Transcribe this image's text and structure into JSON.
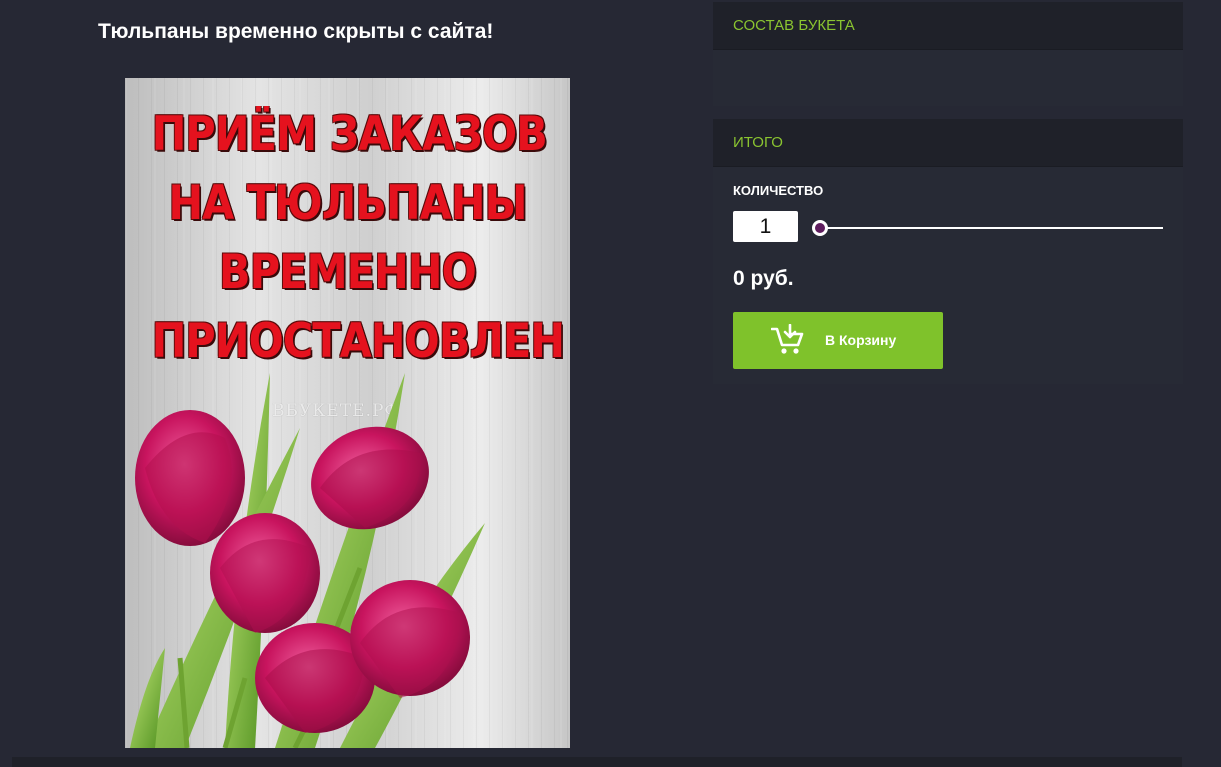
{
  "product": {
    "notice_title": "Тюльпаны временно скрыты с сайта!"
  },
  "poster": {
    "lines": [
      "ПРИЁМ ЗАКАЗОВ",
      "НА ТЮЛЬПАНЫ",
      "ВРЕМЕННО",
      "ПРИОСТАНОВЛЕН"
    ],
    "watermark": "ВБУКЕТЕ.РФ",
    "text_color": "#e5121e"
  },
  "bouquet_panel": {
    "header": "СОСТАВ БУКЕТА"
  },
  "total_panel": {
    "header": "ИТОГО",
    "quantity_label": "КОЛИЧЕСТВО",
    "quantity_value": "1",
    "quantity_slider_level": 0,
    "price": "0 руб.",
    "cart_button_label": "В Корзину",
    "cart_icon": "cart-add-icon"
  },
  "colors": {
    "background": "#262834",
    "header_background": "#1f2129",
    "accent_green": "#7fc22b",
    "header_text_green": "#8ac430",
    "slider_thumb": "#5e1d5e"
  }
}
